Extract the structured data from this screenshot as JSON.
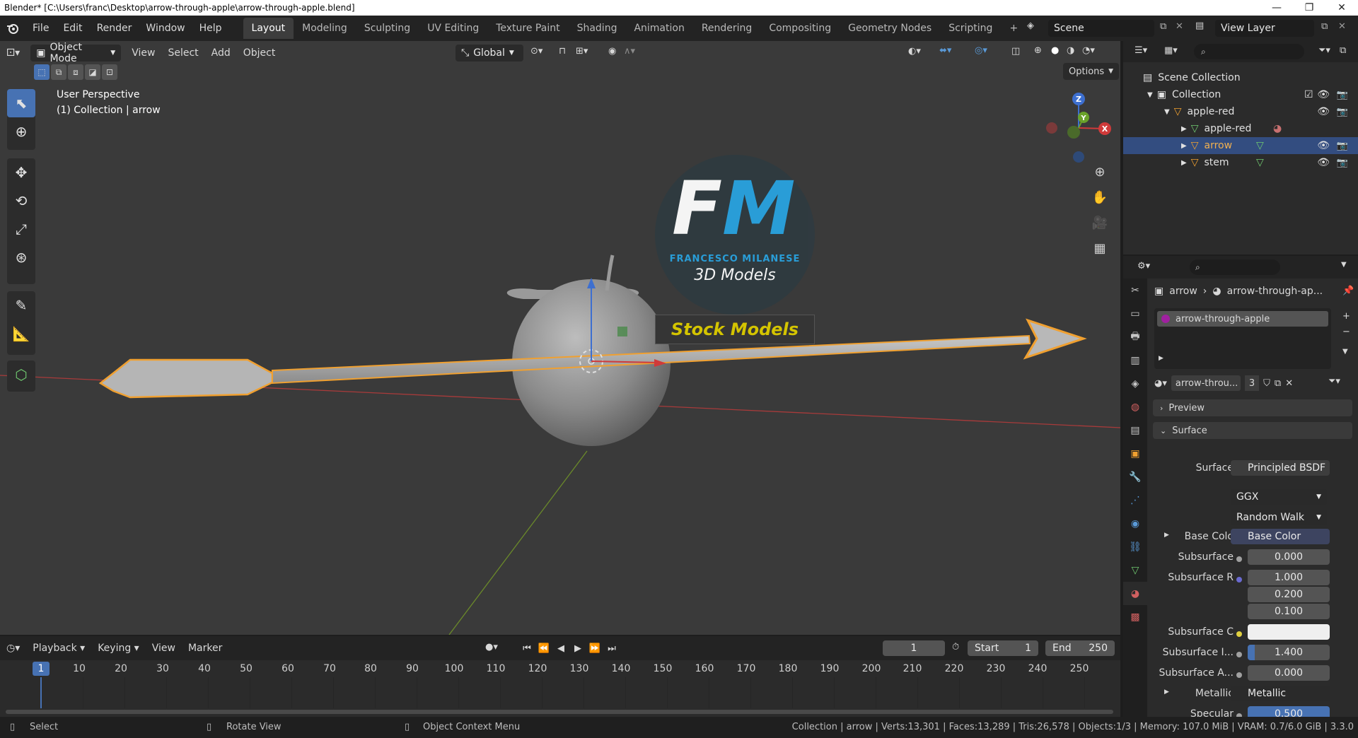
{
  "window": {
    "title": "Blender* [C:\\Users\\franc\\Desktop\\arrow-through-apple\\arrow-through-apple.blend]",
    "minimize": "—",
    "maximize": "❐",
    "close": "✕"
  },
  "menubar": {
    "items": [
      "File",
      "Edit",
      "Render",
      "Window",
      "Help"
    ],
    "workspaces": [
      "Layout",
      "Modeling",
      "Sculpting",
      "UV Editing",
      "Texture Paint",
      "Shading",
      "Animation",
      "Rendering",
      "Compositing",
      "Geometry Nodes",
      "Scripting"
    ],
    "active_workspace": "Layout",
    "add_workspace": "+",
    "scene": "Scene",
    "view_layer": "View Layer"
  },
  "viewport_header": {
    "mode": "Object Mode",
    "menus": [
      "View",
      "Select",
      "Add",
      "Object"
    ],
    "transform_orientation": "Global",
    "options": "Options"
  },
  "viewport": {
    "perspective_label": "User Perspective",
    "collection_label": "(1) Collection | arrow",
    "gizmo_axes": {
      "x": "X",
      "y": "Y",
      "z": "Z"
    },
    "watermark": {
      "monogram_f": "F",
      "monogram_m": "M",
      "studio": "FRANCESCO MILANESE",
      "models": "3D Models",
      "stock": "Stock Models"
    }
  },
  "toolbar": {
    "tools": [
      "select-box",
      "cursor",
      "move",
      "rotate",
      "scale",
      "transform",
      "annotate",
      "measure",
      "add-cube"
    ],
    "active_tool": "select-box"
  },
  "outliner": {
    "search_placeholder": "",
    "rows": [
      {
        "label": "Scene Collection",
        "depth": 0
      },
      {
        "label": "Collection",
        "depth": 1
      },
      {
        "label": "apple-red",
        "depth": 2
      },
      {
        "label": "apple-red",
        "depth": 3
      },
      {
        "label": "arrow",
        "depth": 3
      },
      {
        "label": "stem",
        "depth": 3
      }
    ]
  },
  "properties": {
    "breadcrumb_object": "arrow",
    "breadcrumb_material": "arrow-through-ap...",
    "material_slot": "arrow-through-apple",
    "material_name": "arrow-throu...",
    "user_count": "3",
    "panels": {
      "preview": "Preview",
      "surface": "Surface"
    },
    "surface_label": "Surface",
    "surface_value": "Principled BSDF",
    "distribution": "GGX",
    "subsurface_method": "Random Walk",
    "fields": [
      {
        "label": "Base Colo",
        "value": "Base Color"
      },
      {
        "label": "Subsurface",
        "value": "0.000"
      },
      {
        "label": "Subsurface R",
        "value": "1.000"
      },
      {
        "label": "",
        "value": "0.200"
      },
      {
        "label": "",
        "value": "0.100"
      },
      {
        "label": "Subsurface C",
        "value": ""
      },
      {
        "label": "Subsurface I...",
        "value": "1.400"
      },
      {
        "label": "Subsurface A...",
        "value": "0.000"
      },
      {
        "label": "Metallic",
        "value": "Metallic"
      },
      {
        "label": "Specular",
        "value": "0.500"
      }
    ]
  },
  "timeline": {
    "menus": [
      "Playback",
      "Keying",
      "View",
      "Marker"
    ],
    "current_frame": "1",
    "start_label": "Start",
    "start": "1",
    "end_label": "End",
    "end": "250",
    "ruler": [
      "1",
      "10",
      "20",
      "30",
      "40",
      "50",
      "60",
      "70",
      "80",
      "90",
      "100",
      "110",
      "120",
      "130",
      "140",
      "150",
      "160",
      "170",
      "180",
      "190",
      "200",
      "210",
      "220",
      "230",
      "240",
      "250"
    ]
  },
  "statusbar": {
    "select": "Select",
    "rotate": "Rotate View",
    "context": "Object Context Menu",
    "stats": "Collection | arrow | Verts:13,301 | Faces:13,289 | Tris:26,578 | Objects:1/3 | Memory: 107.0 MiB | VRAM: 0.7/6.0 GiB | 3.3.0"
  },
  "colors": {
    "accent": "#4772b3",
    "selection_outline": "#f0a030",
    "outliner_selected": "#334d80",
    "watermark_blue": "#29a3e0",
    "stock_yellow": "#d4c400"
  }
}
